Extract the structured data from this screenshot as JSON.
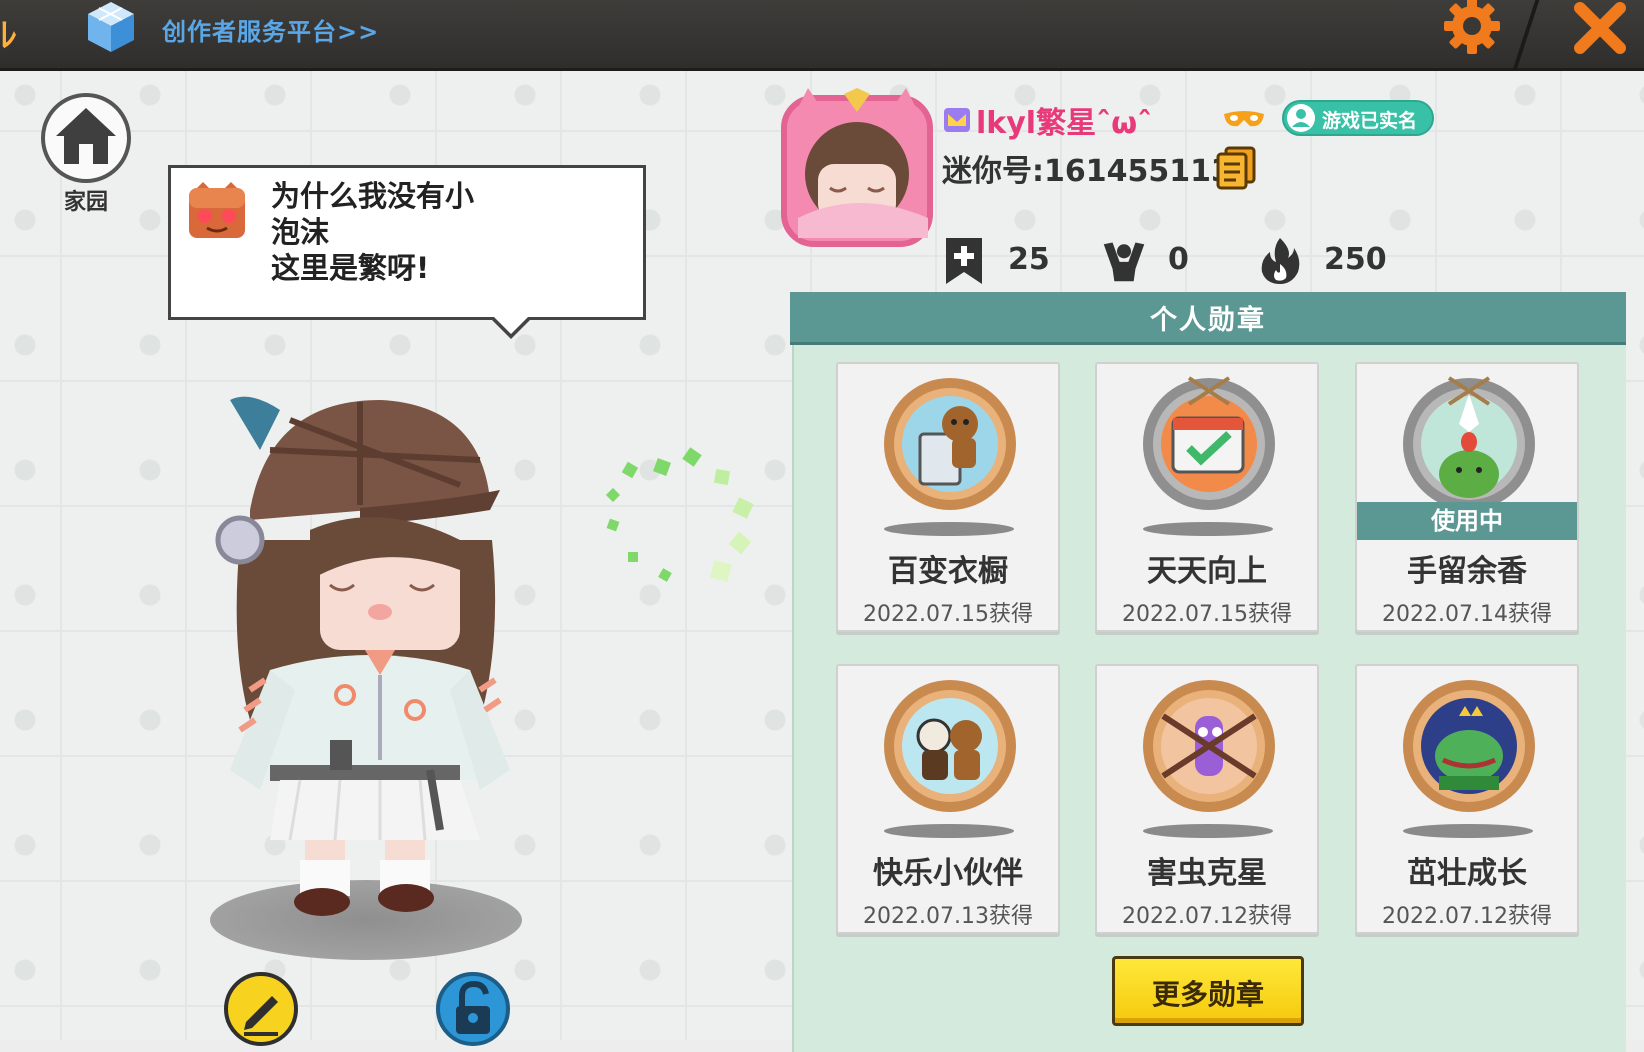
{
  "topbar": {
    "creator_link": "创作者服务平台>>",
    "icons": [
      "cube-icon",
      "gear-icon",
      "close-icon"
    ]
  },
  "home": {
    "label": "家园"
  },
  "bubble": {
    "line1": "为什么我没有小",
    "line2": "泡沫",
    "line3": "这里是繁呀!"
  },
  "profile": {
    "username": "lkyl繁星ˆωˆ",
    "realname_badge": "游戏已实名",
    "mini_id": "迷你号:1614551132",
    "stats": {
      "friends": "25",
      "fans": "0",
      "heat": "250"
    }
  },
  "medals": {
    "header": "个人勋章",
    "in_use_label": "使用中",
    "items": [
      {
        "name": "百变衣橱",
        "date": "2022.07.15获得",
        "in_use": false
      },
      {
        "name": "天天向上",
        "date": "2022.07.15获得",
        "in_use": false
      },
      {
        "name": "手留余香",
        "date": "2022.07.14获得",
        "in_use": true
      },
      {
        "name": "快乐小伙伴",
        "date": "2022.07.13获得",
        "in_use": false
      },
      {
        "name": "害虫克星",
        "date": "2022.07.12获得",
        "in_use": false
      },
      {
        "name": "茁壮成长",
        "date": "2022.07.12获得",
        "in_use": false
      }
    ],
    "more_button": "更多勋章"
  },
  "colors": {
    "accent_orange": "#f07a1c",
    "teal_header": "#5c9893",
    "panel_green": "#d3eadc",
    "button_yellow": "#f5c90c",
    "username_pink": "#e83a7a"
  }
}
